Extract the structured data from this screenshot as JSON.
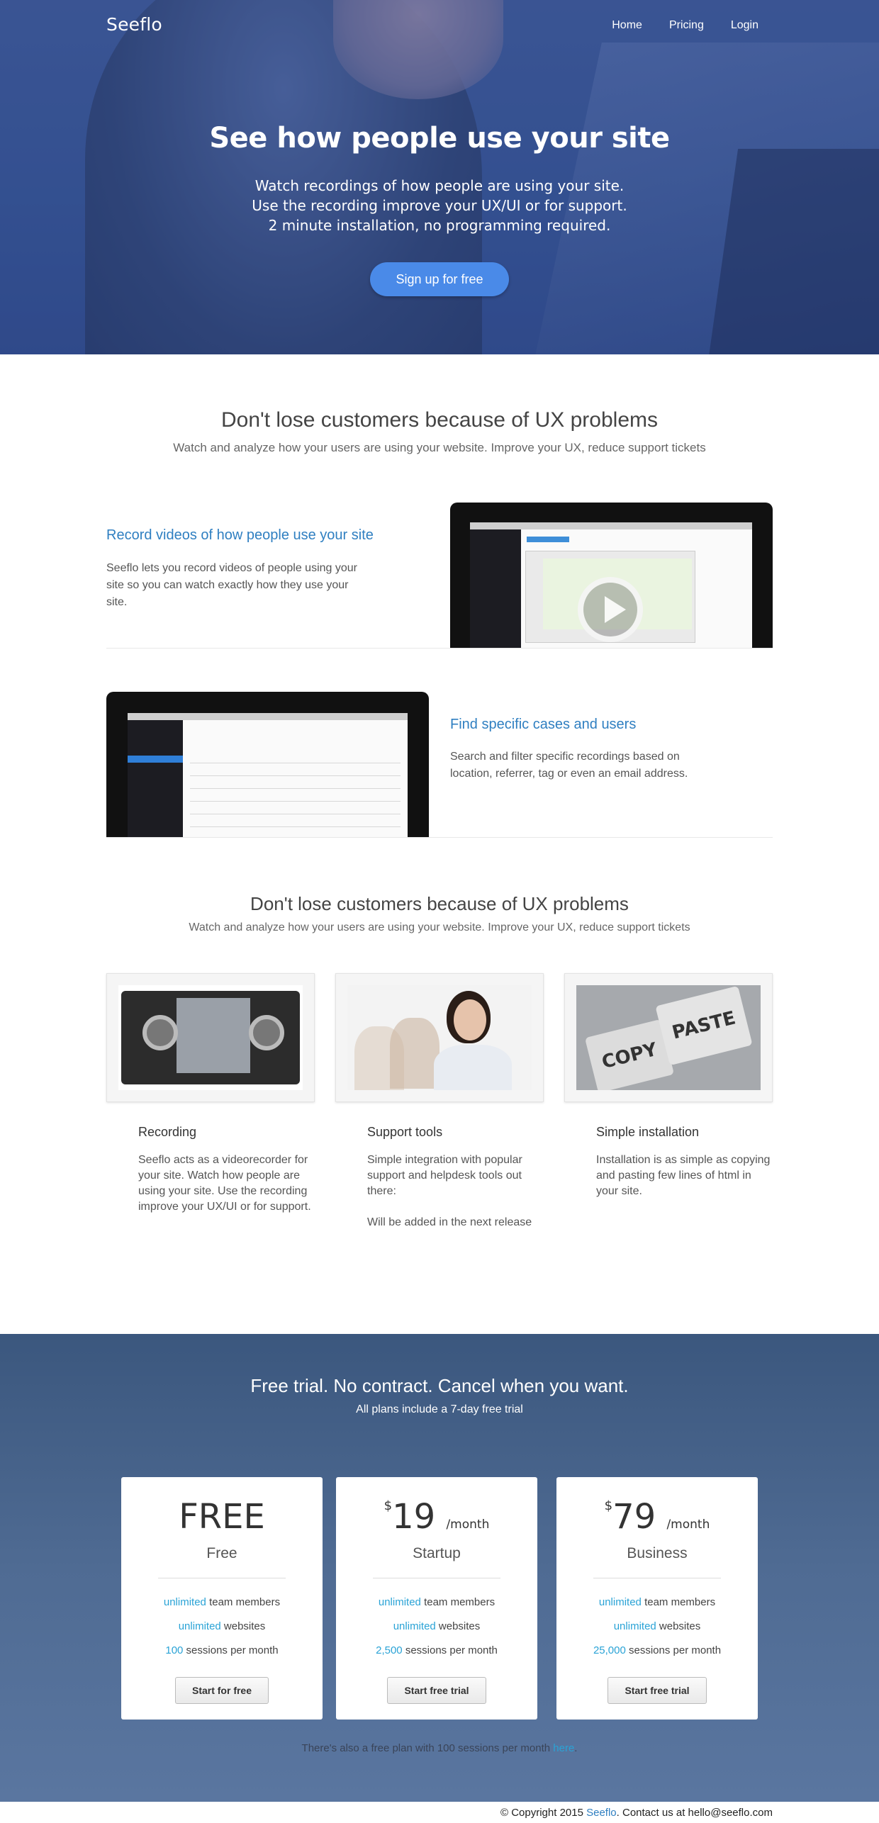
{
  "brand": "Seeflo",
  "nav": {
    "home": "Home",
    "pricing": "Pricing",
    "login": "Login"
  },
  "hero": {
    "title": "See how people use your site",
    "line1": "Watch recordings of how people are using your site.",
    "line2": "Use the recording improve your UX/UI or for support.",
    "line3": "2 minute installation, no programming required.",
    "cta": "Sign up for free"
  },
  "intro": {
    "title": "Don't lose customers because of UX problems",
    "subtitle": "Watch and analyze how your users are using your website. Improve your UX, reduce support tickets"
  },
  "features": [
    {
      "title": "Record videos of how people use your site",
      "text": "Seeflo lets you record videos of people using your site so you can watch exactly how they use your site."
    },
    {
      "title": "Find specific cases and users",
      "text": "Search and filter specific recordings based on location, referrer, tag or even an email address."
    }
  ],
  "section2": {
    "title": "Don't lose customers because of UX problems",
    "subtitle": "Watch and analyze how your users are using your website. Improve your UX, reduce support tickets"
  },
  "cards": [
    {
      "title": "Recording",
      "text": "Seeflo acts as a videorecorder for your site. Watch how people are using your site. Use the recording improve your UX/UI or for support.",
      "icon": "vhs-tape-image"
    },
    {
      "title": "Support tools",
      "text": "Simple integration with popular support and helpdesk tools out there:",
      "extra": "Will be added in the next release",
      "icon": "support-agent-image"
    },
    {
      "title": "Simple installation",
      "text": "Installation is as simple as copying and pasting few lines of html in your site.",
      "icon": "copy-paste-keys-image"
    }
  ],
  "keys": {
    "copy": "COPY",
    "paste": "PASTE"
  },
  "pricing": {
    "title": "Free trial. No contract. Cancel when you want.",
    "subtitle": "All plans include a 7-day free trial",
    "plans": [
      {
        "price": "FREE",
        "name": "Free",
        "members_hl": "unlimited",
        "members": " team members",
        "sites_hl": "unlimited",
        "sites": " websites",
        "sessions_hl": "100",
        "sessions": " sessions per month",
        "button": "Start for free"
      },
      {
        "currency": "$",
        "price": "19",
        "per": "/month",
        "name": "Startup",
        "members_hl": "unlimited",
        "members": " team members",
        "sites_hl": "unlimited",
        "sites": " websites",
        "sessions_hl": "2,500",
        "sessions": " sessions per month",
        "button": "Start free trial"
      },
      {
        "currency": "$",
        "price": "79",
        "per": "/month",
        "name": "Business",
        "members_hl": "unlimited",
        "members": " team members",
        "sites_hl": "unlimited",
        "sites": " websites",
        "sessions_hl": "25,000",
        "sessions": " sessions per month",
        "button": "Start free trial"
      }
    ],
    "note": "There's also a free plan with 100 sessions per month ",
    "note_link": "here",
    "note_end": "."
  },
  "footer": {
    "prefix": "© Copyright 2015 ",
    "link": "Seeflo",
    "suffix": ". Contact us at hello@seeflo.com"
  },
  "colors": {
    "accent": "#2f7fc1",
    "cta": "#4a8ae8",
    "highlight": "#2aa3d6",
    "pricing_bg": "#4a6690"
  }
}
